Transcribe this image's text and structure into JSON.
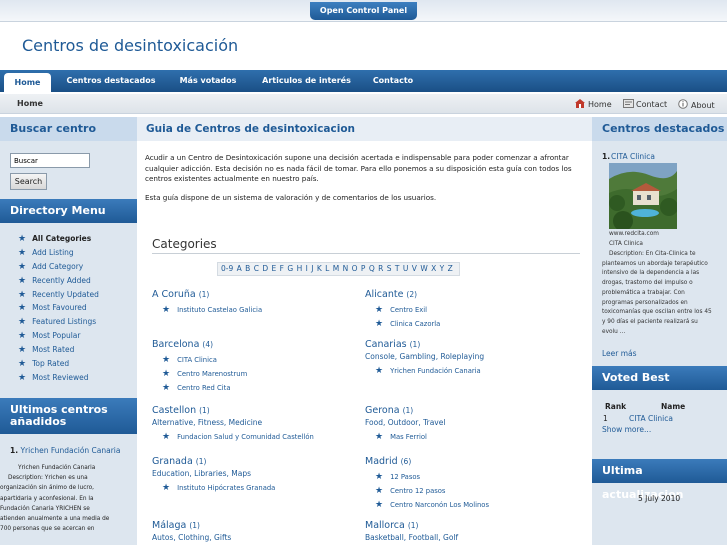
{
  "top_bar": {
    "open_panel_label": "Open Control Panel"
  },
  "site": {
    "title": "Centros de desintoxicación"
  },
  "nav": [
    "Home",
    "Centros destacados",
    "Más votados",
    "Articulos de interés",
    "Contacto"
  ],
  "breadcrumb": {
    "current": "Home"
  },
  "utility_links": [
    "Home",
    "Contact",
    "About"
  ],
  "left": {
    "search_title": "Buscar centro",
    "search_placeholder": "Buscar",
    "search_button": "Search",
    "directory_title": "Directory Menu",
    "directory_items": [
      "All Categories",
      "Add Listing",
      "Add Category",
      "Recently Added",
      "Recently Updated",
      "Most Favoured",
      "Featured Listings",
      "Most Popular",
      "Most Rated",
      "Top Rated",
      "Most Reviewed"
    ],
    "latest_title_1": "Ultimos centros",
    "latest_title_2": "añadidos",
    "latest_item_num": "1.",
    "latest_item_link": "Yrichen Fundación Canaria",
    "latest_text": [
      "Yrichen Fundación Canaria",
      "Description: Yrichen es una",
      "organización sin ánimo de lucro,",
      "apartidaria y aconfesional. En la",
      "Fundación Canaria YRICHEN se",
      "atienden anualmente a una media de",
      "700 personas que se acercan en"
    ]
  },
  "main": {
    "title": "Guia de Centros de desintoxicacion",
    "intro": "Acudir a un Centro de Desintoxicación supone una decisión acertada e indispensable para poder comenzar a afrontar cualquier adicción. Esta decisión no es nada fácil de tomar. Para ello ponemos a su disposición esta guía con todos los centros existentes actualmente en nuestro país.",
    "intro2": "Esta guía dispone de un sistema de valoración y de comentarios de los usuarios.",
    "categories_heading": "Categories",
    "alphabet": [
      "0-9",
      "A",
      "B",
      "C",
      "D",
      "E",
      "F",
      "G",
      "H",
      "I",
      "J",
      "K",
      "L",
      "M",
      "N",
      "O",
      "P",
      "Q",
      "R",
      "S",
      "T",
      "U",
      "V",
      "W",
      "X",
      "Y",
      "Z"
    ],
    "categories_left": [
      {
        "name": "A Coruña",
        "count": "(1)",
        "tags": "",
        "items": [
          "Instituto Castelao Galicia"
        ]
      },
      {
        "name": "Barcelona",
        "count": "(4)",
        "tags": "",
        "items": [
          "CITA Clinica",
          "Centro Marenostrum",
          "Centro Red Cita"
        ]
      },
      {
        "name": "Castellon",
        "count": "(1)",
        "tags": "Alternative, Fitness, Medicine",
        "items": [
          "Fundacion Salud y Comunidad Castellón"
        ]
      },
      {
        "name": "Granada",
        "count": "(1)",
        "tags": "Education, Libraries, Maps",
        "items": [
          "Instituto Hipócrates Granada"
        ]
      },
      {
        "name": "Málaga",
        "count": "(1)",
        "tags": "Autos, Clothing, Gifts",
        "items": []
      }
    ],
    "categories_right": [
      {
        "name": "Alicante",
        "count": "(2)",
        "tags": "",
        "items": [
          "Centro Exil",
          "Clinica Cazorla"
        ]
      },
      {
        "name": "Canarias",
        "count": "(1)",
        "tags": "Console, Gambling, Roleplaying",
        "items": [
          "Yrichen Fundación Canaria"
        ]
      },
      {
        "name": "Gerona",
        "count": "(1)",
        "tags": "Food, Outdoor, Travel",
        "items": [
          "Mas Ferriol"
        ]
      },
      {
        "name": "Madrid",
        "count": "(6)",
        "tags": "",
        "items": [
          "12 Pasos",
          "Centro 12 pasos",
          "Centro Narconón Los Molinos"
        ]
      },
      {
        "name": "Mallorca",
        "count": "(1)",
        "tags": "Basketball, Football, Golf",
        "items": []
      }
    ]
  },
  "right": {
    "featured_title": "Centros destacados",
    "featured_num": "1.",
    "featured_link": "CITA Clinica",
    "featured_url": "www.redcita.com",
    "featured_name": "CITA Clinica",
    "featured_desc": [
      "Description: En Cita-Clinica te",
      "planteamos un abordaje terapéutico",
      "intensivo de la dependencia a las",
      "drogas, trastorno del impulso o",
      "problemática a trabajar. Con",
      "programas personalizados en",
      "toxicomanías que oscilan entre los 45",
      "y 90 días el paciente realizará su",
      "evolu ..."
    ],
    "leer_mas": "Leer más",
    "voted_title": "Voted Best",
    "voted_rank_header": "Rank",
    "voted_name_header": "Name",
    "voted_rank": "1",
    "voted_name": "CITA Clinica",
    "show_more": "Show more...",
    "update_title": "Ultima actualizacion",
    "update_date": "5 July 2010"
  }
}
